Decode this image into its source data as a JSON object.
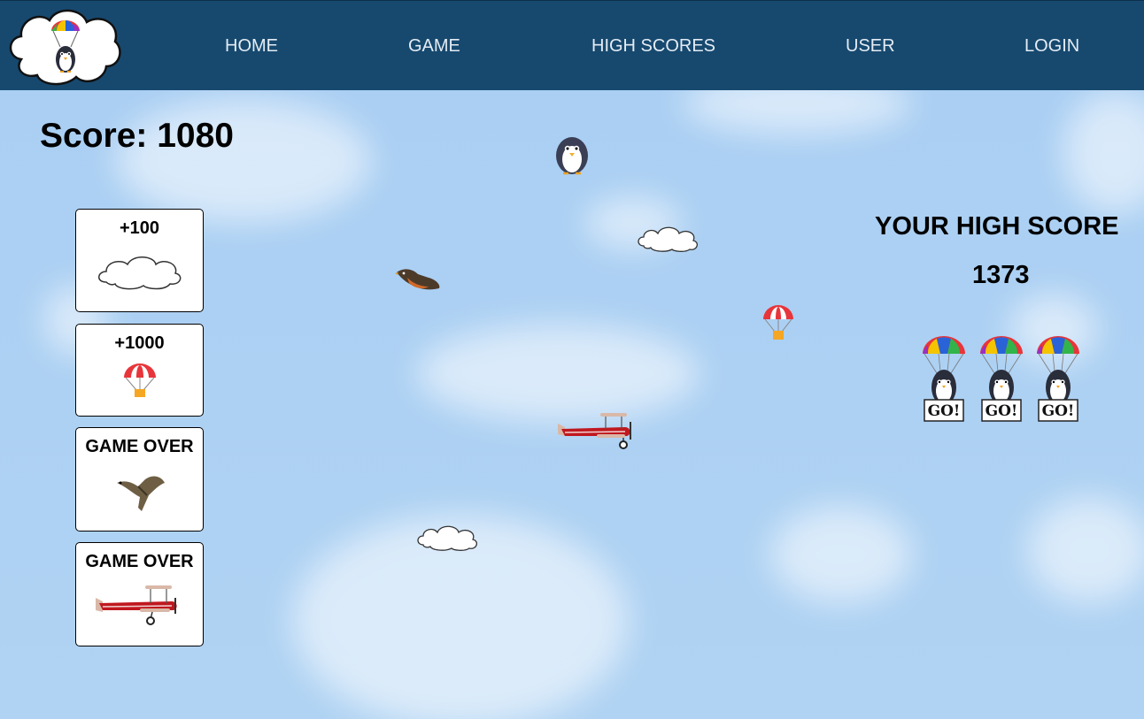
{
  "nav": {
    "home": "HOME",
    "game": "GAME",
    "high_scores": "HIGH SCORES",
    "user": "USER",
    "login": "LOGIN"
  },
  "game": {
    "score_label": "Score:",
    "score_value": "1080"
  },
  "legend": [
    {
      "text": "+100",
      "icon": "cloud-icon"
    },
    {
      "text": "+1000",
      "icon": "parachute-crate-icon"
    },
    {
      "text": "GAME OVER",
      "icon": "bird-icon"
    },
    {
      "text": "GAME OVER",
      "icon": "biplane-icon"
    }
  ],
  "high_score": {
    "title": "YOUR HIGH SCORE",
    "value": "1373"
  },
  "lives": {
    "sign_text": "GO!"
  },
  "colors": {
    "nav_bg": "#17496f",
    "nav_text": "#e4ecf4",
    "sky": "#add0f2",
    "plane_red": "#c0181f",
    "parachute_red": "#e8353b"
  }
}
